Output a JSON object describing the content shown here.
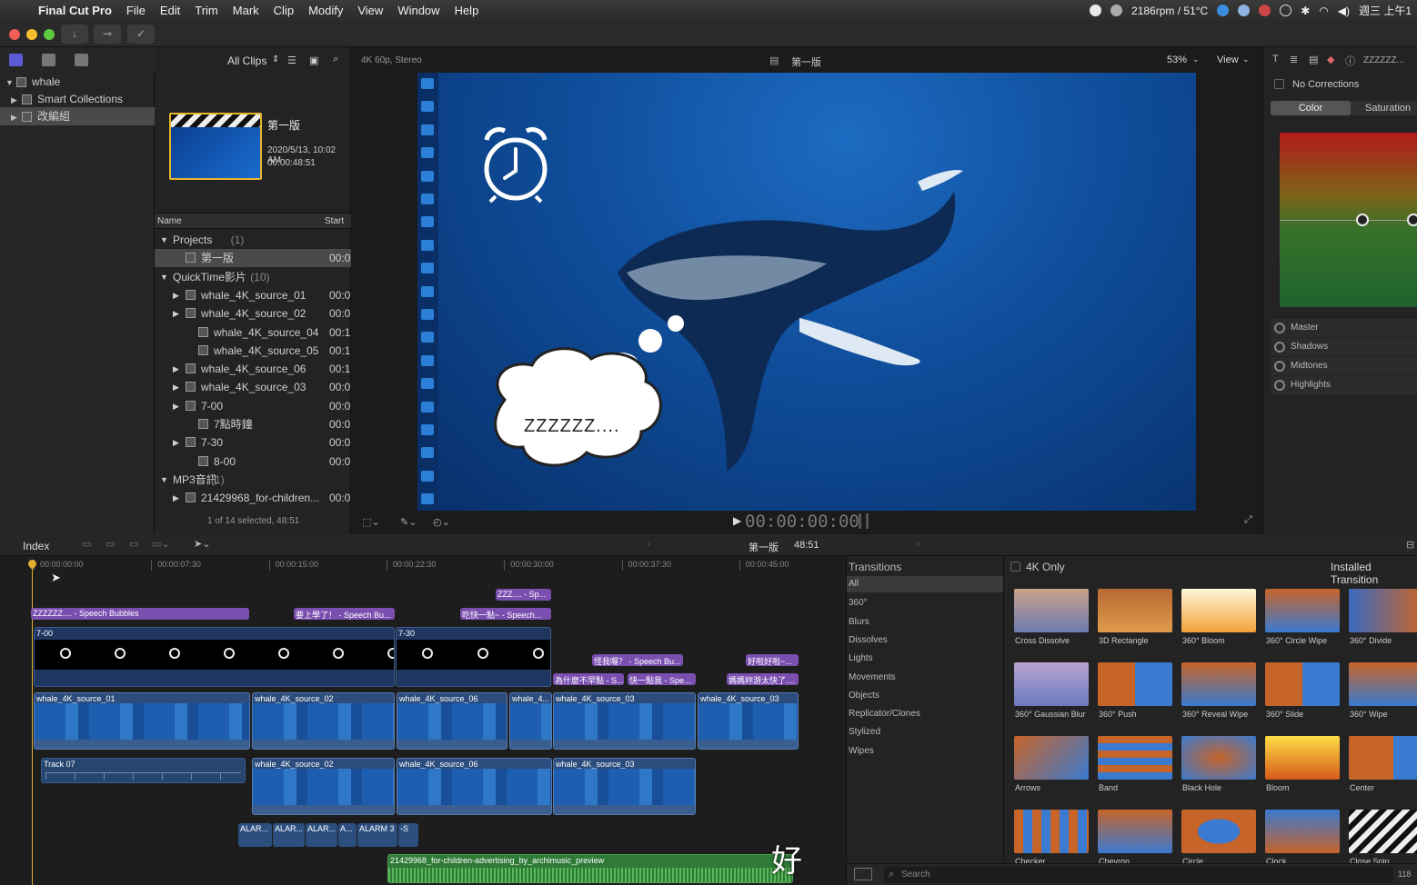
{
  "menubar": {
    "app": "Final Cut Pro",
    "items": [
      "File",
      "Edit",
      "Trim",
      "Mark",
      "Clip",
      "Modify",
      "View",
      "Window",
      "Help"
    ],
    "status": "2186rpm / 51°C",
    "clock": "週三 上午1"
  },
  "library": {
    "name": "whale",
    "smart_collections": "Smart Collections",
    "event": "改編組"
  },
  "browser": {
    "filter": "All Clips",
    "project_name": "第一版",
    "project_date": "2020/5/13, 10:02 AM",
    "project_duration": "00:00:48:51",
    "col_name": "Name",
    "col_start": "Start",
    "rows": [
      {
        "name": "Projects",
        "count": "(1)",
        "start": ""
      },
      {
        "name": "第一版",
        "count": "",
        "start": "00:0"
      },
      {
        "name": "QuickTime影片",
        "count": "(10)",
        "start": ""
      },
      {
        "name": "whale_4K_source_01",
        "count": "",
        "start": "00:0"
      },
      {
        "name": "whale_4K_source_02",
        "count": "",
        "start": "00:0"
      },
      {
        "name": "whale_4K_source_04",
        "count": "",
        "start": "00:1"
      },
      {
        "name": "whale_4K_source_05",
        "count": "",
        "start": "00:1"
      },
      {
        "name": "whale_4K_source_06",
        "count": "",
        "start": "00:1"
      },
      {
        "name": "whale_4K_source_03",
        "count": "",
        "start": "00:0"
      },
      {
        "name": "7-00",
        "count": "",
        "start": "00:0"
      },
      {
        "name": "7點時鐘",
        "count": "",
        "start": "00:0"
      },
      {
        "name": "7-30",
        "count": "",
        "start": "00:0"
      },
      {
        "name": "8-00",
        "count": "",
        "start": "00:0"
      },
      {
        "name": "MP3音訊",
        "count": "(1)",
        "start": ""
      },
      {
        "name": "21429968_for-children...",
        "count": "",
        "start": "00:0"
      }
    ],
    "footer": "1 of 14 selected, 48:51"
  },
  "viewer": {
    "format": "4K 60p, Stereo",
    "title": "第一版",
    "zoom": "53%",
    "view": "View",
    "bubble_text": "ZZZZZZ....",
    "timecode": "00:00:00:00"
  },
  "inspector": {
    "title": "ZZZZZZ...",
    "corrections": "No Corrections",
    "tab_color": "Color",
    "tab_saturation": "Saturation",
    "ranges": [
      "Master",
      "Shadows",
      "Midtones",
      "Highlights"
    ]
  },
  "timeline": {
    "index": "Index",
    "project": "第一版",
    "duration": "48:51",
    "ruler": [
      "00:00:00:00",
      "00:00:07:30",
      "00:00:15:00",
      "00:00:22:30",
      "00:00:30:00",
      "00:00:37:30",
      "00:00:45:00"
    ],
    "titles": {
      "t1": "ZZZZZZ.... - Speech Bubbles",
      "t2": "要上學了！ - Speech Bu...",
      "t3": "吃快一點~ - Speech...",
      "t4": "ZZZ.... - Sp...",
      "t5": "怪我囉？ - Speech Bu...",
      "t6": "好啦好啦~...",
      "t7": "為什麼不早點 - S...",
      "t8": "快一點我 - Spe...",
      "t9": "媽媽妳游太快了...."
    },
    "compound1": "7-00",
    "compound2": "7-30",
    "primary": [
      "whale_4K_source_01",
      "whale_4K_source_02",
      "whale_4K_source_06",
      "whale_4...",
      "whale_4K_source_03",
      "whale_4K_source_03"
    ],
    "track07": "Track 07",
    "secondary": [
      "whale_4K_source_02",
      "whale_4K_source_06",
      "whale_4K_source_03"
    ],
    "alarms": [
      "ALAR...",
      "ALAR...",
      "ALAR...",
      "A...",
      "ALARM 3",
      "-S"
    ],
    "music": "21429968_for-children-advertising_by_archimusic_preview",
    "subtitle": "好"
  },
  "transitions": {
    "title": "Transitions",
    "filter": "4K Only",
    "installed": "Installed Transition",
    "categories": [
      "All",
      "360°",
      "Blurs",
      "Dissolves",
      "Lights",
      "Movements",
      "Objects",
      "Replicator/Clones",
      "Stylized",
      "Wipes"
    ],
    "items": [
      "Cross Dissolve",
      "3D Rectangle",
      "360° Bloom",
      "360° Circle Wipe",
      "360° Divide",
      "360° Gaussian Blur",
      "360° Push",
      "360° Reveal Wipe",
      "360° Slide",
      "360° Wipe",
      "Arrows",
      "Band",
      "Black Hole",
      "Bloom",
      "Center",
      "Checker",
      "Chevron",
      "Circle",
      "Clock",
      "Close Spin"
    ],
    "search": "Search",
    "count": "118"
  }
}
